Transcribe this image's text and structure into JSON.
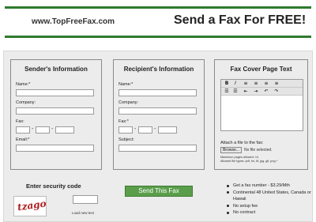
{
  "header": {
    "site_url": "www.TopFreeFax.com",
    "tagline": "Send a Fax For FREE!"
  },
  "sender": {
    "title": "Sender's Information",
    "name_label": "Name:*",
    "company_label": "Company:",
    "fax_label": "Fax:",
    "email_label": "Email:*",
    "dash": "-"
  },
  "recipient": {
    "title": "Recipient's Information",
    "name_label": "Name:*",
    "company_label": "Company:",
    "fax_label": "Fax:*",
    "subject_label": "Subject:",
    "dash": "-"
  },
  "cover": {
    "title": "Fax Cover Page Text",
    "toolbar_row1": [
      "B",
      "I",
      "≡",
      "≡",
      "≡",
      "≡"
    ],
    "toolbar_row2": [
      "☰",
      "☰",
      "⇤",
      "⇥",
      "↶",
      "↷"
    ],
    "attach_label": "Attach a file to the fax:",
    "browse_label": "Browse...",
    "file_status": "No file selected.",
    "max_pages": "Maximum pages allowed: 14",
    "allowed_types": "Allowed file types: pdf, txt, tif, jpg, gif, png *"
  },
  "security": {
    "title": "Enter security code",
    "captcha_text": "tzago",
    "load_new": "Load new text"
  },
  "send_button": "Send This Fax",
  "promo": {
    "items": [
      "Get a fax number - $3.29/Mth",
      "Continental 48 United States, Canada or Hawaii",
      "No setup fee",
      "No contract"
    ]
  }
}
